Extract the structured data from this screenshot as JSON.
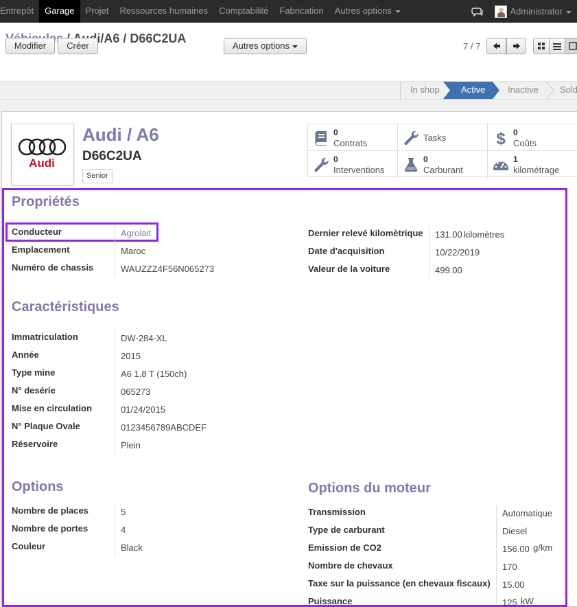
{
  "nav": {
    "items": [
      "Entrepôt",
      "Garage",
      "Projet",
      "Ressources humaines",
      "Comptabilité",
      "Fabrication",
      "Autres options"
    ],
    "user": "Administrator"
  },
  "breadcrumb": {
    "root": "Véhicules",
    "sep": " / ",
    "current": "Audi/A6 / D66C2UA"
  },
  "toolbar": {
    "edit_label": "Modifier",
    "create_label": "Créer",
    "more_label": "Autres options",
    "pager": "7 / 7"
  },
  "stages": {
    "inshop": "In shop",
    "active": "Active",
    "inactive": "Inactive",
    "sold": "Sold"
  },
  "vehicle": {
    "model": "Audi / A6",
    "plate": "D66C2UA",
    "tag": "Senior",
    "logo_text": "Audi"
  },
  "stats": [
    {
      "num": "0",
      "label": "Contrats",
      "icon": "book-icon"
    },
    {
      "num": "",
      "label": "Tasks",
      "icon": "wrench-icon"
    },
    {
      "num": "0",
      "label": "Coûts",
      "icon": "dollar-icon"
    },
    {
      "num": "0",
      "label": "Interventions",
      "icon": "wrench-icon"
    },
    {
      "num": "0",
      "label": "Carburant",
      "icon": "flask-icon"
    },
    {
      "num": "1",
      "label": "kilométrage",
      "icon": "dashboard-icon"
    }
  ],
  "properties": {
    "title": "Propriétés",
    "left": [
      {
        "label": "Conducteur",
        "value": "Agrolait"
      },
      {
        "label": "Emplacement",
        "value": "Maroc"
      },
      {
        "label": "Numéro de chassis",
        "value": "WAUZZZ4F56N065273"
      }
    ],
    "right": [
      {
        "label": "Dernier relevé kilomètrique",
        "value": "131.00",
        "unit": "kilomètres"
      },
      {
        "label": "Date d'acquisition",
        "value": "10/22/2019"
      },
      {
        "label": "Valeur de la voiture",
        "value": "499.00"
      }
    ]
  },
  "characteristics": {
    "title": "Caractéristiques",
    "rows": [
      {
        "label": "Immatriculation",
        "value": "DW-284-XL"
      },
      {
        "label": "Année",
        "value": "2015"
      },
      {
        "label": "Type mine",
        "value": "A6 1.8 T (150ch)"
      },
      {
        "label": "N° desérie",
        "value": "065273"
      },
      {
        "label": "Mise en circulation",
        "value": "01/24/2015"
      },
      {
        "label": "N° Plaque Ovale",
        "value": "0123456789ABCDEF"
      },
      {
        "label": "Réservoire",
        "value": "Plein"
      }
    ]
  },
  "options": {
    "title": "Options",
    "rows": [
      {
        "label": "Nombre de places",
        "value": "5"
      },
      {
        "label": "Nombre de portes",
        "value": "4"
      },
      {
        "label": "Couleur",
        "value": "Black"
      }
    ]
  },
  "engine": {
    "title": "Options du moteur",
    "rows": [
      {
        "label": "Transmission",
        "value": "Automatique"
      },
      {
        "label": "Type de carburant",
        "value": "Diesel"
      },
      {
        "label": "Emission de CO2",
        "value": "156.00",
        "unit": "g/km"
      },
      {
        "label": "Nombre de chevaux",
        "value": "170"
      },
      {
        "label": "Taxe sur la puissance (en chevaux fiscaux)",
        "value": "15.00"
      },
      {
        "label": "Puissance",
        "value": "125",
        "unit": "kW"
      }
    ]
  },
  "colors": {
    "accent": "#7c7bad",
    "highlight": "#8a2be2",
    "active_stage": "#3f72b3",
    "navbar": "#2b2b2b"
  }
}
